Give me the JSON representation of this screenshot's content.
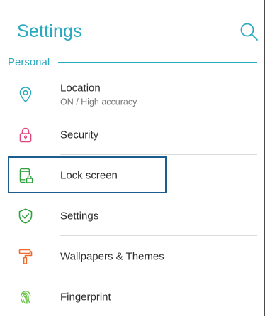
{
  "appbar": {
    "title": "Settings",
    "search_icon": "search-icon"
  },
  "section": {
    "label": "Personal"
  },
  "items": [
    {
      "title": "Location",
      "subtitle": "ON / High accuracy",
      "icon": "location-icon",
      "color": "#29a9bd"
    },
    {
      "title": "Security",
      "icon": "lock-icon",
      "color": "#e0457b"
    },
    {
      "title": "Lock screen",
      "icon": "lock-screen-icon",
      "color": "#33a03f",
      "highlighted": true
    },
    {
      "title": "Settings",
      "icon": "shield-check-icon",
      "color": "#33a03f"
    },
    {
      "title": "Wallpapers & Themes",
      "icon": "paint-roller-icon",
      "color": "#f06a2c"
    },
    {
      "title": "Fingerprint",
      "icon": "fingerprint-icon",
      "color": "#6cc24a"
    }
  ],
  "colors": {
    "accent": "#29a9bd",
    "highlight_border": "#1d5d8d"
  }
}
